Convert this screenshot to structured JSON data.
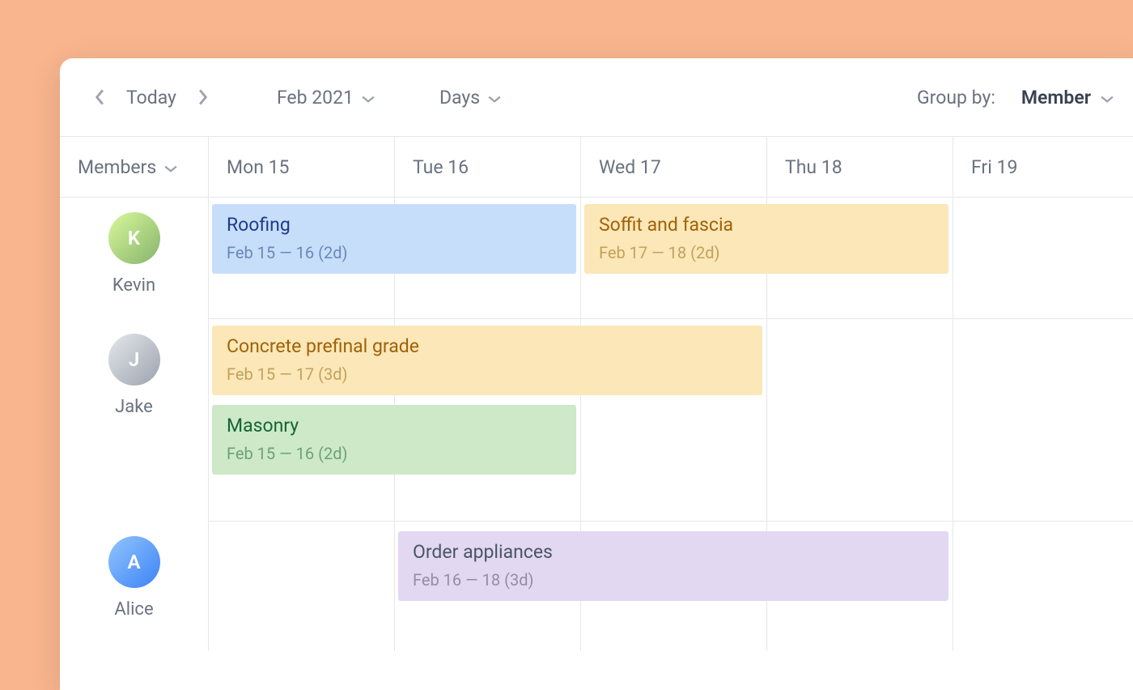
{
  "toolbar": {
    "today_label": "Today",
    "month_label": "Feb 2021",
    "unit_label": "Days",
    "group_by_label": "Group by:",
    "group_by_value": "Member"
  },
  "columns": {
    "members_header": "Members",
    "days": [
      "Mon 15",
      "Tue 16",
      "Wed 17",
      "Thu 18",
      "Fri 19"
    ]
  },
  "members": [
    {
      "name": "Kevin",
      "initial": "K",
      "avatar_class": "green"
    },
    {
      "name": "Jake",
      "initial": "J",
      "avatar_class": "gray"
    },
    {
      "name": "Alice",
      "initial": "A",
      "avatar_class": "blue"
    }
  ],
  "tasks": {
    "roofing": {
      "title": "Roofing",
      "sub": "Feb 15  — 16 (2d)"
    },
    "soffit": {
      "title": "Soffit and fascia",
      "sub": "Feb 17  — 18 (2d)"
    },
    "concrete": {
      "title": "Concrete prefinal grade",
      "sub": "Feb 15  — 17 (3d)"
    },
    "masonry": {
      "title": "Masonry",
      "sub": "Feb 15  — 16 (2d)"
    },
    "appliances": {
      "title": "Order appliances",
      "sub": "Feb 16  — 18 (3d)"
    }
  }
}
